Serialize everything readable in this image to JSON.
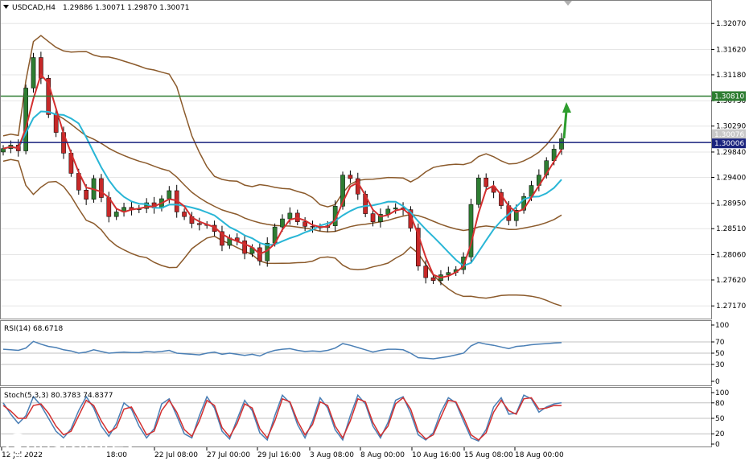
{
  "header": {
    "symbol": "USDCAD,H4",
    "ohlc": "1.29886 1.30071 1.29870 1.30071"
  },
  "chart_data": [
    {
      "type": "candlestick",
      "title": "USDCAD,H4 1.29886 1.30071 1.29870 1.30071",
      "ylim": [
        1.2695,
        1.3245
      ],
      "y_ticks": [
        "1.32070",
        "1.31620",
        "1.31180",
        "1.30730",
        "1.30290",
        "1.29840",
        "1.29400",
        "1.28950",
        "1.28510",
        "1.28060",
        "1.27620",
        "1.27170"
      ],
      "series": [
        {
          "name": "Price",
          "values": [
            1.299,
            1.2996,
            1.2986,
            1.3095,
            1.3148,
            1.3112,
            1.3049,
            1.3018,
            1.2982,
            1.2947,
            1.2918,
            1.2902,
            1.2938,
            1.2905,
            1.2872,
            1.288,
            1.2888,
            1.2884,
            1.2886,
            1.2896,
            1.2887,
            1.2903,
            1.2917,
            1.288,
            1.2872,
            1.286,
            1.2858,
            1.2857,
            1.2846,
            1.2822,
            1.2835,
            1.283,
            1.2808,
            1.2818,
            1.2795,
            1.2826,
            1.2854,
            1.2868,
            1.2878,
            1.2863,
            1.2855,
            1.2854,
            1.2853,
            1.2856,
            1.289,
            1.2944,
            1.2938,
            1.2911,
            1.2877,
            1.2863,
            1.2876,
            1.2885,
            1.2887,
            1.2884,
            1.2852,
            1.2786,
            1.2766,
            1.2761,
            1.2771,
            1.2775,
            1.278,
            1.2802,
            1.2893,
            1.2939,
            1.2924,
            1.2914,
            1.2891,
            1.2865,
            1.2883,
            1.2907,
            1.2926,
            1.2944,
            1.2969,
            1.2989,
            1.3007
          ]
        }
      ],
      "lines": [
        {
          "name": "Support/Resistance",
          "value": 1.3081,
          "color": "#2e7d32"
        },
        {
          "name": "Current price",
          "value": 1.30006,
          "color": "#1a237e"
        }
      ],
      "price_tags": [
        "1.30810",
        "1.30076",
        "1.30006"
      ],
      "indicators": [
        "Bollinger Bands",
        "Moving average (red)",
        "Moving average (cyan)"
      ]
    },
    {
      "type": "line",
      "title": "RSI(14) 68.6718",
      "ylim": [
        0,
        100
      ],
      "y_ticks": [
        "100",
        "70",
        "50",
        "30",
        "0"
      ],
      "levels": [
        70,
        50,
        30
      ],
      "series": [
        {
          "name": "RSI(14)",
          "values": [
            57,
            56,
            55,
            59,
            71,
            66,
            62,
            60,
            56,
            54,
            50,
            52,
            56,
            53,
            50,
            51,
            52,
            51,
            51,
            53,
            52,
            53,
            55,
            50,
            49,
            48,
            47,
            50,
            52,
            48,
            50,
            48,
            46,
            48,
            45,
            51,
            55,
            57,
            58,
            55,
            53,
            54,
            53,
            55,
            59,
            67,
            64,
            60,
            56,
            52,
            55,
            57,
            57,
            56,
            50,
            42,
            41,
            40,
            42,
            44,
            47,
            50,
            63,
            69,
            66,
            64,
            61,
            58,
            62,
            63,
            65,
            66,
            67,
            68,
            68.67
          ]
        }
      ],
      "color": "#4a7fb5"
    },
    {
      "type": "line",
      "title": "Stoch(5,3,3) 80.3783 74.8377",
      "ylim": [
        0,
        100
      ],
      "y_ticks": [
        "100",
        "80",
        "50",
        "20",
        "0"
      ],
      "levels": [
        80,
        50,
        20
      ],
      "series": [
        {
          "name": "%K",
          "values": [
            80,
            58,
            40,
            55,
            92,
            75,
            50,
            25,
            12,
            30,
            65,
            92,
            70,
            35,
            15,
            40,
            80,
            68,
            35,
            12,
            30,
            78,
            88,
            55,
            20,
            12,
            55,
            92,
            70,
            25,
            10,
            48,
            85,
            65,
            22,
            8,
            55,
            95,
            80,
            38,
            12,
            45,
            90,
            70,
            28,
            8,
            55,
            95,
            78,
            35,
            12,
            42,
            85,
            92,
            60,
            18,
            8,
            22,
            62,
            90,
            80,
            45,
            12,
            6,
            28,
            72,
            90,
            58,
            60,
            95,
            88,
            62,
            72,
            78,
            80.38
          ]
        },
        {
          "name": "%D",
          "values": [
            75,
            64,
            50,
            50,
            75,
            78,
            60,
            35,
            18,
            25,
            55,
            85,
            75,
            45,
            22,
            32,
            68,
            72,
            45,
            18,
            25,
            65,
            85,
            62,
            28,
            15,
            45,
            85,
            75,
            32,
            14,
            40,
            78,
            70,
            30,
            12,
            45,
            88,
            82,
            45,
            18,
            38,
            82,
            75,
            35,
            12,
            45,
            88,
            82,
            42,
            16,
            35,
            78,
            90,
            68,
            25,
            10,
            18,
            52,
            85,
            82,
            52,
            18,
            8,
            22,
            62,
            85,
            65,
            58,
            88,
            90,
            68,
            70,
            75,
            74.84
          ]
        }
      ]
    }
  ],
  "x_labels": [
    "12 Jul 2022",
    "18:00",
    "22 Jul 08:00",
    "27 Jul 00:00",
    "29 Jul 16:00",
    "3 Aug 08:00",
    "8 Aug 00:00",
    "10 Aug 16:00",
    "15 Aug 08:00",
    "18 Aug 00:00"
  ],
  "colors": {
    "candle_up": "#2e7d32",
    "candle_down": "#c62828",
    "wick": "#000000",
    "bands": "#8b5a2b",
    "ma_red": "#d32f2f",
    "ma_cyan": "#29b6d6",
    "rsi": "#4a7fb5",
    "stoch_k": "#4a7fb5",
    "stoch_d": "#d32f2f",
    "support_line": "#2e7d32",
    "price_line": "#1a237e",
    "arrow": "#2e9d2e"
  },
  "watermark": {
    "brand": "instaforex",
    "tagline": "Instant Forex Trading"
  },
  "icons": [
    "scroll-marker-icon",
    "dropdown-triangle-icon",
    "instaforex-logo-icon"
  ]
}
